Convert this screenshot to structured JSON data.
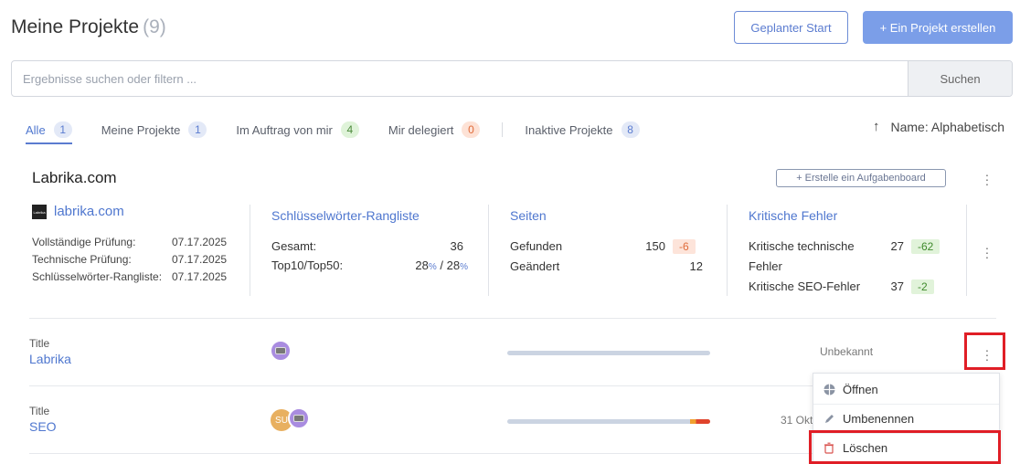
{
  "header": {
    "title": "Meine Projekte",
    "count": "(9)",
    "planned_start_label": "Geplanter Start",
    "create_project_label": "+ Ein Projekt erstellen"
  },
  "search": {
    "placeholder": "Ergebnisse suchen oder filtern ...",
    "button_label": "Suchen"
  },
  "tabs": [
    {
      "label": "Alle",
      "count": "1",
      "color": "#e3e9f7"
    },
    {
      "label": "Meine Projekte",
      "count": "1",
      "color": "#e3e9f7"
    },
    {
      "label": "Im Auftrag von mir",
      "count": "4",
      "color": "#dff3d9"
    },
    {
      "label": "Mir delegiert",
      "count": "0",
      "color": "#fde2d6"
    },
    {
      "label": "Inaktive Projekte",
      "count": "8",
      "color": "#e3e9f7"
    }
  ],
  "sort": {
    "arrow": "↑",
    "label": "Name: Alphabetisch"
  },
  "project": {
    "name": "Labrika.com",
    "board_button": "+ Erstelle ein Aufgabenboard",
    "logo_text": "Labrika",
    "domain": "labrika.com",
    "checks": [
      {
        "label": "Vollständige Prüfung:",
        "date": "07.17.2025"
      },
      {
        "label": "Technische Prüfung:",
        "date": "07.17.2025"
      },
      {
        "label": "Schlüsselwörter-Rangliste:",
        "date": "07.17.2025"
      }
    ],
    "keywords": {
      "heading": "Schlüsselwörter-Rangliste",
      "total_label": "Gesamt:",
      "total_value": "36",
      "top_label": "Top10/Top50:",
      "top10": "28",
      "top50": "28",
      "pct": "%",
      "slash": " / "
    },
    "pages": {
      "heading": "Seiten",
      "found_label": "Gefunden",
      "found_value": "150",
      "found_delta": "-6",
      "changed_label": "Geändert",
      "changed_value": "12"
    },
    "errors": {
      "heading": "Kritische Fehler",
      "tech_label_1": "Kritische technische",
      "tech_label_2": "Fehler",
      "tech_value": "27",
      "tech_delta": "-62",
      "seo_label": "Kritische SEO-Fehler",
      "seo_value": "37",
      "seo_delta": "-2"
    }
  },
  "tasks": [
    {
      "label": "Title",
      "name": "Labrika",
      "status": "Unbekannt",
      "progress": 0
    },
    {
      "label": "Title",
      "name": "SEO",
      "status": "31 Okt",
      "avatar_initials": "SU",
      "progress": 0.1
    }
  ],
  "context_menu": {
    "items": [
      {
        "label": "Öffnen",
        "icon": "grid-icon"
      },
      {
        "label": "Umbenennen",
        "icon": "pencil-icon"
      },
      {
        "label": "Löschen",
        "icon": "trash-icon"
      }
    ]
  },
  "colors": {
    "accent": "#5b7cd0",
    "primary_button": "#7b9ee8",
    "highlight": "#e01e26",
    "negative": "#e06b3a",
    "positive": "#3f8a2c"
  }
}
